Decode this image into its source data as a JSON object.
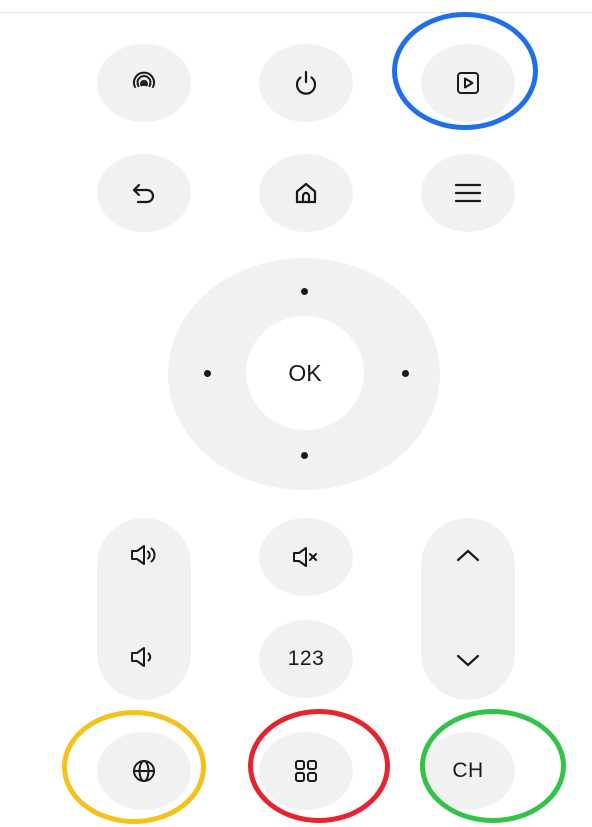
{
  "remote": {
    "rows": {
      "top": [
        "cast-icon",
        "power-icon",
        "play-input-icon"
      ],
      "second": [
        "back-icon",
        "home-icon",
        "menu-icon"
      ]
    },
    "dpad": {
      "ok_label": "OK",
      "directions": [
        "up",
        "down",
        "left",
        "right"
      ]
    },
    "volume": {
      "up_icon": "volume-up-icon",
      "down_icon": "volume-down-icon"
    },
    "mute_icon": "mute-icon",
    "number_label": "123",
    "channel": {
      "up_icon": "chevron-up-icon",
      "down_icon": "chevron-down-icon"
    },
    "bottom": {
      "globe_icon": "globe-icon",
      "apps_icon": "apps-grid-icon",
      "ch_label": "CH"
    }
  },
  "highlights": [
    {
      "target": "play-input-button",
      "color": "#1f6fe8"
    },
    {
      "target": "globe-button",
      "color": "#f5c21b"
    },
    {
      "target": "apps-button",
      "color": "#e5242f"
    },
    {
      "target": "ch-button",
      "color": "#33c24a"
    }
  ]
}
